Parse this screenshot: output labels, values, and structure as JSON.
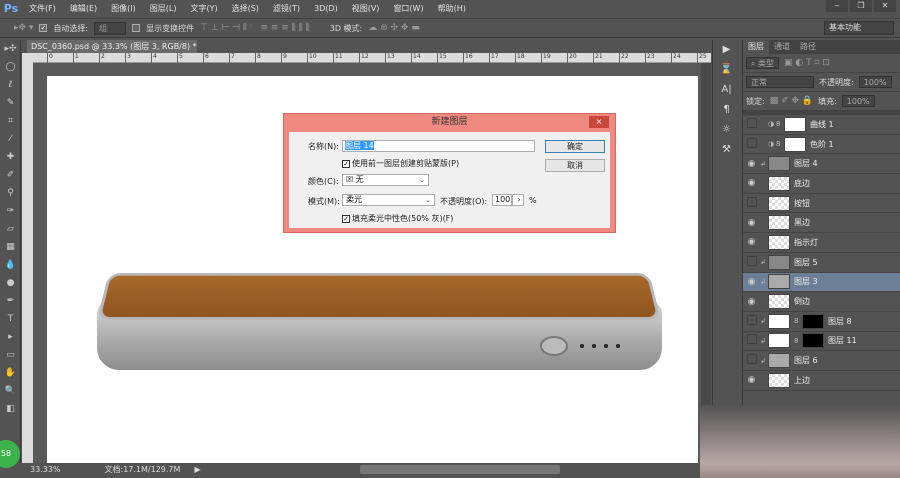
{
  "app": {
    "logo": "Ps",
    "menu": [
      "文件(F)",
      "编辑(E)",
      "图像(I)",
      "图层(L)",
      "文字(Y)",
      "选择(S)",
      "滤镜(T)",
      "3D(D)",
      "视图(V)",
      "窗口(W)",
      "帮助(H)"
    ],
    "window_buttons": [
      "‒",
      "❐",
      "✕"
    ]
  },
  "options": {
    "auto_select_label": "自动选择:",
    "auto_select_value": "组",
    "show_transform_label": "显示变换控件",
    "mode_3d_label": "3D 模式:",
    "workspace": "基本功能"
  },
  "document": {
    "tab_title": "DSC_0360.psd @ 33.3% (图层 3, RGB/8) *",
    "ruler_ticks": [
      "0",
      "1",
      "2",
      "3",
      "4",
      "5",
      "6",
      "7",
      "8",
      "9",
      "10",
      "11",
      "12",
      "13",
      "14",
      "15",
      "16",
      "17",
      "18",
      "19",
      "20",
      "21",
      "22",
      "23",
      "24",
      "25"
    ]
  },
  "status": {
    "zoom": "33.33%",
    "doc_size": "文档:17.1M/129.7M",
    "badge": "58"
  },
  "dialog": {
    "title": "新建图层",
    "close": "×",
    "name_label": "名称(N):",
    "name_value": "图层 14",
    "use_prev_clip_label": "使用前一图层创建剪贴蒙版(P)",
    "use_prev_clip_checked": true,
    "color_label": "颜色(C):",
    "color_value": "无",
    "mode_label": "模式(M):",
    "mode_value": "柔光",
    "opacity_label": "不透明度(O):",
    "opacity_value": "100",
    "opacity_unit": "%",
    "fill_neutral_label": "填充柔光中性色(50% 灰)(F)",
    "fill_neutral_checked": true,
    "ok": "确定",
    "cancel": "取消"
  },
  "layers_panel": {
    "tabs": [
      "图层",
      "通道",
      "路径"
    ],
    "filter_label": "类型",
    "blend_mode": "正常",
    "opacity_label": "不透明度:",
    "opacity_value": "100%",
    "lock_label": "锁定:",
    "fill_label": "填充:",
    "fill_value": "100%",
    "layers": [
      {
        "name": "曲线 1",
        "visible": false,
        "clip": false,
        "type": "adjust"
      },
      {
        "name": "色阶 1",
        "visible": false,
        "clip": false,
        "type": "adjust"
      },
      {
        "name": "图层 4",
        "visible": true,
        "clip": true,
        "type": "gray"
      },
      {
        "name": "底边",
        "visible": true,
        "clip": false,
        "type": "check"
      },
      {
        "name": "按钮",
        "visible": false,
        "clip": false,
        "type": "check"
      },
      {
        "name": "黑边",
        "visible": true,
        "clip": false,
        "type": "check"
      },
      {
        "name": "指示灯",
        "visible": true,
        "clip": false,
        "type": "check"
      },
      {
        "name": "图层 5",
        "visible": false,
        "clip": true,
        "type": "gray"
      },
      {
        "name": "图层 3",
        "visible": true,
        "clip": true,
        "type": "lgray",
        "selected": true
      },
      {
        "name": "倒边",
        "visible": true,
        "clip": false,
        "type": "check"
      },
      {
        "name": "图层 8",
        "visible": false,
        "clip": true,
        "type": "mask"
      },
      {
        "name": "图层 11",
        "visible": false,
        "clip": true,
        "type": "mask"
      },
      {
        "name": "图层 6",
        "visible": false,
        "clip": true,
        "type": "lgray"
      },
      {
        "name": "上边",
        "visible": true,
        "clip": false,
        "type": "check"
      }
    ]
  }
}
